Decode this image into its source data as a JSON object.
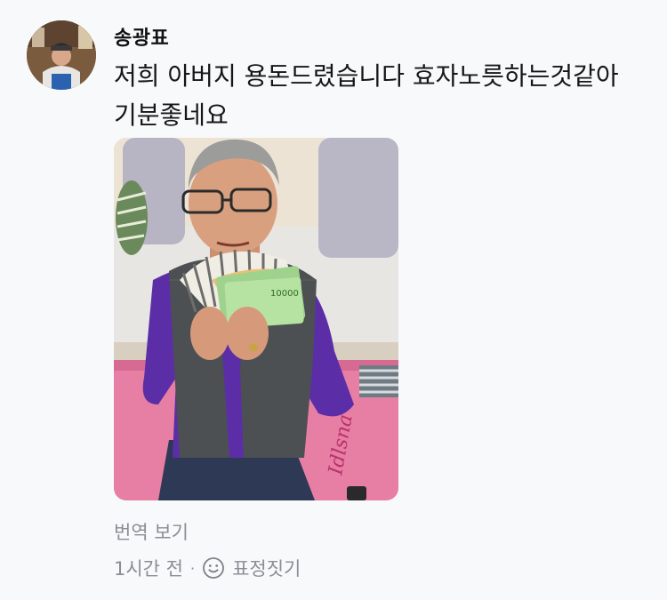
{
  "comment": {
    "author": "송광표",
    "text": "저희 아버지 용돈드렸습니다 효자노릇하는것같아 기분좋네요",
    "translate_link": "번역 보기",
    "timestamp": "1시간 전",
    "separator": "·",
    "react_label": "표정짓기",
    "react_icon": "smiley-icon",
    "avatar_icon": "user-avatar",
    "photo_icon": "attached-photo"
  }
}
